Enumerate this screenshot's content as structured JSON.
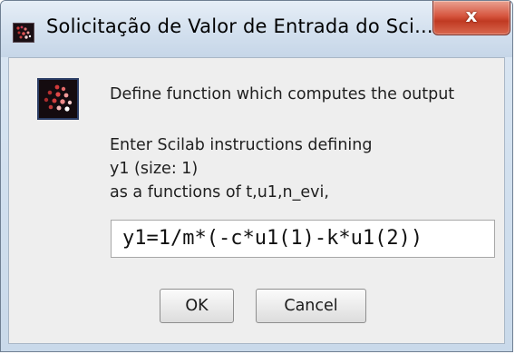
{
  "window": {
    "title": "Solicitação de Valor de Entrada do Sci...",
    "close_label": "x"
  },
  "dialog": {
    "heading": "Define function which computes the output",
    "lines": [
      "Enter Scilab instructions defining",
      "y1 (size: 1)",
      "as a functions of t,u1,n_evi,"
    ],
    "input_value": "y1=1/m*(-c*u1(1)-k*u1(2))",
    "ok_label": "OK",
    "cancel_label": "Cancel"
  },
  "icons": {
    "title_icon": "scilab-app-icon",
    "message_icon": "scilab-dots-icon",
    "close_icon": "close-icon"
  },
  "colors": {
    "close_button": "#c03a22",
    "titlebar": "#d3e0ee",
    "client_background": "#eeeeee"
  }
}
